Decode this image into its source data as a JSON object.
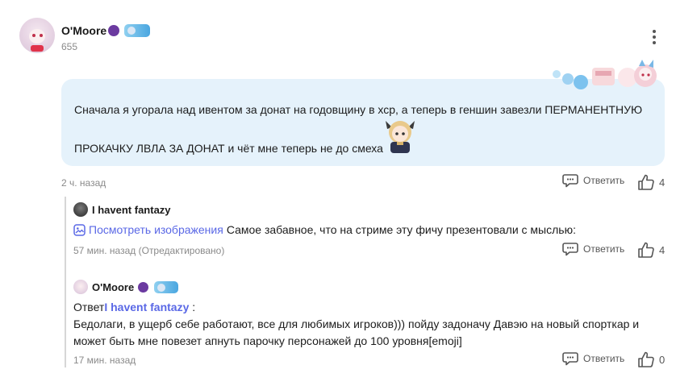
{
  "post": {
    "author_name": "O'Moore",
    "author_sub": "655",
    "text_line1": "Сначала я угорала над ивентом за донат на годовщину в хср, а теперь в геншин завезли ПЕРМАНЕНТНУЮ",
    "text_line2": "ПРОКАЧКУ ЛВЛА ЗА ДОНАТ и чёт мне теперь не до смеха",
    "time": "2 ч. назад",
    "reply_label": "Ответить",
    "likes": "4"
  },
  "comments": [
    {
      "author_name": "I havent fantazy",
      "view_images_label": "Посмотреть изображения",
      "text": "Самое забавное, что на стриме эту фичу презентовали с мыслью:",
      "time": "57 мин. назад (Отредактировано)",
      "reply_label": "Ответить",
      "likes": "4"
    },
    {
      "author_name": "O'Moore",
      "reply_prefix": "Ответ",
      "reply_to": "I havent fantazy",
      "reply_suffix": " :",
      "text_line1": "Бедолаги, в ущерб себе работают, все для любимых игроков))) пойду задоначу Давэю на новый спорткар и",
      "text_line2": "может быть мне повезет апнуть парочку персонажей до 100 уровня[emoji]",
      "time": "17 мин. назад",
      "reply_label": "Ответить",
      "likes": "0"
    }
  ],
  "colors": {
    "bubble": "#e5f2fb",
    "link": "#5a68e6",
    "meta": "#8a8a8a"
  },
  "icons": [
    "more-vertical-icon",
    "chat-bubble-icon",
    "thumbs-up-icon",
    "image-icon"
  ]
}
